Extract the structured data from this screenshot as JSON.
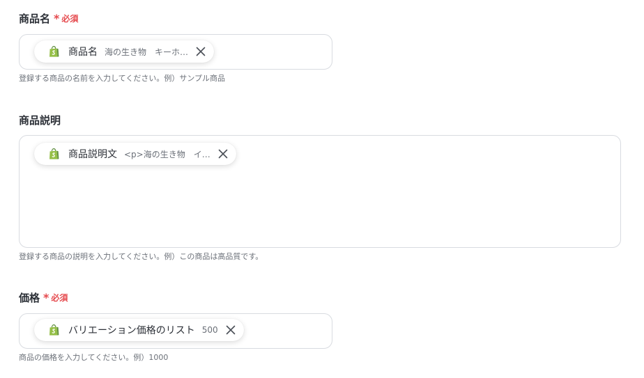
{
  "required_mark": "*",
  "required_text": "必須",
  "colors": {
    "required": "#e5494d",
    "border": "#d8dbe0",
    "shopify_green": "#95bf47",
    "shopify_dark": "#5e8e3e"
  },
  "fields": [
    {
      "label": "商品名",
      "required": true,
      "chip": {
        "icon": "shopify-icon",
        "label": "商品名",
        "value": "海の生き物　キーホ…"
      },
      "help": "登録する商品の名前を入力してください。例）サンプル商品"
    },
    {
      "label": "商品説明",
      "required": false,
      "chip": {
        "icon": "shopify-icon",
        "label": "商品説明文",
        "value": "<p>海の生き物　イ…"
      },
      "help": "登録する商品の説明を入力してください。例）この商品は高品質です。"
    },
    {
      "label": "価格",
      "required": true,
      "chip": {
        "icon": "shopify-icon",
        "label": "バリエーション価格のリスト",
        "value": "500"
      },
      "help": "商品の価格を入力してください。例）1000"
    }
  ]
}
